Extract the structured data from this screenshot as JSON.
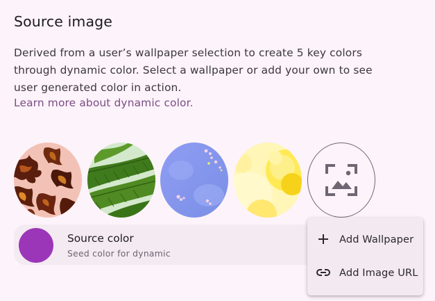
{
  "section": {
    "title": "Source image",
    "description_lines": [
      "Derived from a user’s wallpaper selection to create 5 key colors",
      "through dynamic color. Select a wallpaper or add your own to see",
      "user generated color in action."
    ],
    "learn_more_link": "Learn more about dynamic color."
  },
  "wallpapers": [
    {
      "name": "autumn-leaves"
    },
    {
      "name": "green-fern"
    },
    {
      "name": "blue-petals"
    },
    {
      "name": "yellow-bubbles"
    }
  ],
  "add_wallpaper": {
    "icon": "add-photo-icon"
  },
  "source_color": {
    "label": "Source color",
    "sublabel": "Seed color for dynamic",
    "color": "#9c36b8"
  },
  "menu": {
    "items": [
      {
        "label": "Add Wallpaper",
        "icon": "plus-icon"
      },
      {
        "label": "Add Image URL",
        "icon": "link-icon"
      }
    ]
  },
  "colors": {
    "background": "#fdf3fa",
    "link": "#7a4d86",
    "surface": "#f4ebf2"
  }
}
